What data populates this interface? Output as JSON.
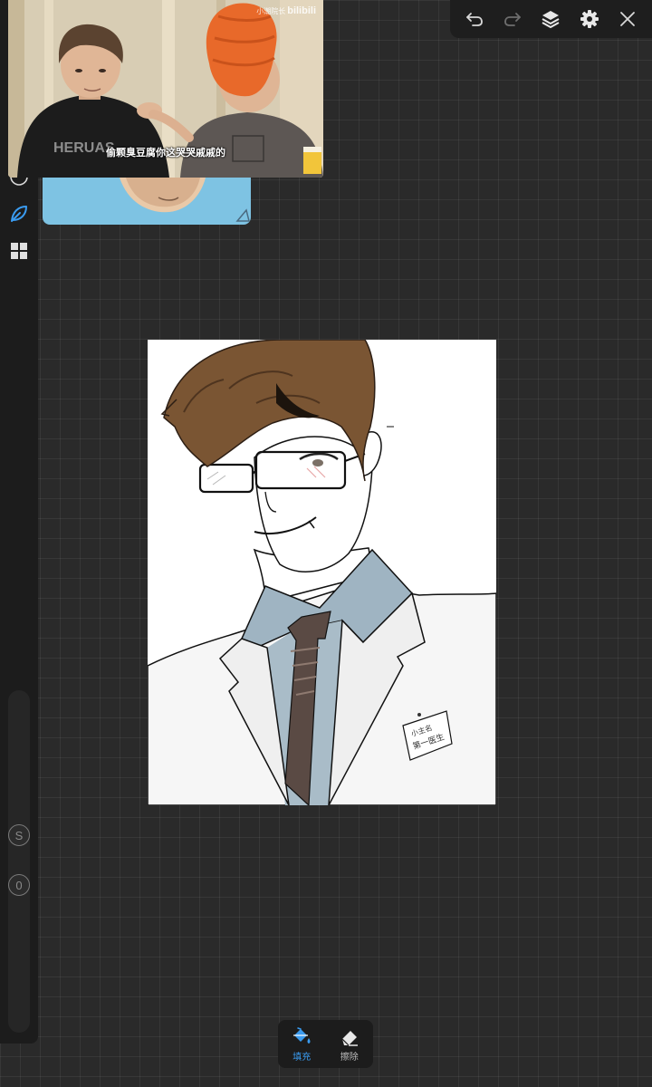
{
  "video": {
    "subtitle": "偷颗臭豆腐你这哭哭戚戚的",
    "watermark_text": "小潮院长",
    "watermark_logo": "bilibili",
    "shirt_text": "HERUAS"
  },
  "name_tag": {
    "line1": "小主名",
    "line2": "第一医生"
  },
  "bottom_tools": {
    "fill_label": "填充",
    "erase_label": "擦除"
  },
  "slider": {
    "badge_s": "S",
    "badge_value": "0"
  },
  "icons": {
    "undo": "undo-icon",
    "redo": "redo-icon",
    "layers": "layers-icon",
    "settings": "gear-icon",
    "close": "close-icon",
    "brush": "leaf-brush-icon",
    "grid": "grid-icon",
    "fill": "paint-bucket-icon",
    "eraser": "eraser-icon"
  },
  "colors": {
    "accent": "#3a9bf0",
    "hair": "#7a5533",
    "shirt": "#9fb4c2",
    "tie": "#5a4a44"
  }
}
